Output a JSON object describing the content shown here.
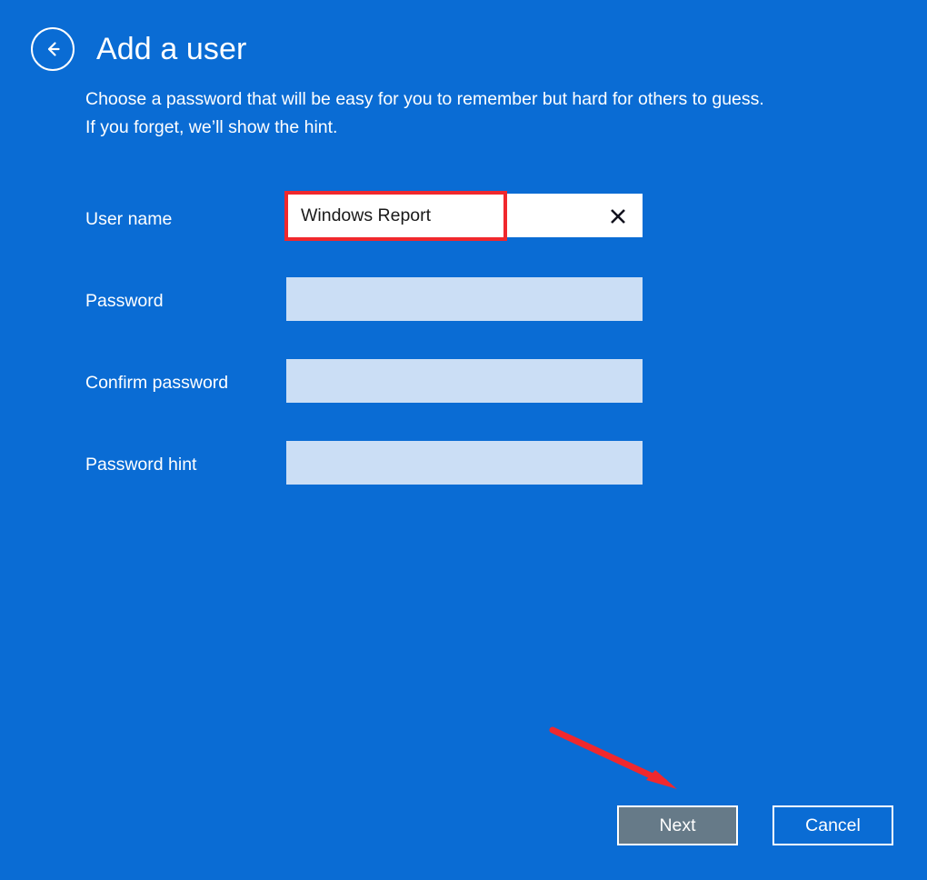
{
  "window": {
    "background_color": "#0a6cd4",
    "accent_color": "#ffffff"
  },
  "header": {
    "back_button_name": "back-arrow-icon",
    "title": "Add a user",
    "subtitle_line1": "Choose a password that will be easy for you to remember but hard for others to guess.",
    "subtitle_line2": "If you forget, we’ll show the hint."
  },
  "form": {
    "fields": [
      {
        "label": "User name",
        "value": "Windows Report",
        "placeholder": "",
        "type": "text",
        "state": "filled",
        "has_clear_button": true
      },
      {
        "label": "Password",
        "value": "",
        "placeholder": "",
        "type": "password",
        "state": "empty",
        "has_clear_button": false
      },
      {
        "label": "Confirm password",
        "value": "",
        "placeholder": "",
        "type": "password",
        "state": "empty",
        "has_clear_button": false
      },
      {
        "label": "Password hint",
        "value": "",
        "placeholder": "",
        "type": "text",
        "state": "empty",
        "has_clear_button": false
      }
    ],
    "clear_icon_name": "clear-x-icon",
    "filled_field_color": "#ffffff",
    "empty_field_color": "#cbdef5"
  },
  "annotations": {
    "highlight_color": "#f0282d",
    "highlight_target": "User name input",
    "arrow_target": "Next button"
  },
  "footer": {
    "next_label": "Next",
    "cancel_label": "Cancel",
    "next_button_color": "#667a88"
  }
}
